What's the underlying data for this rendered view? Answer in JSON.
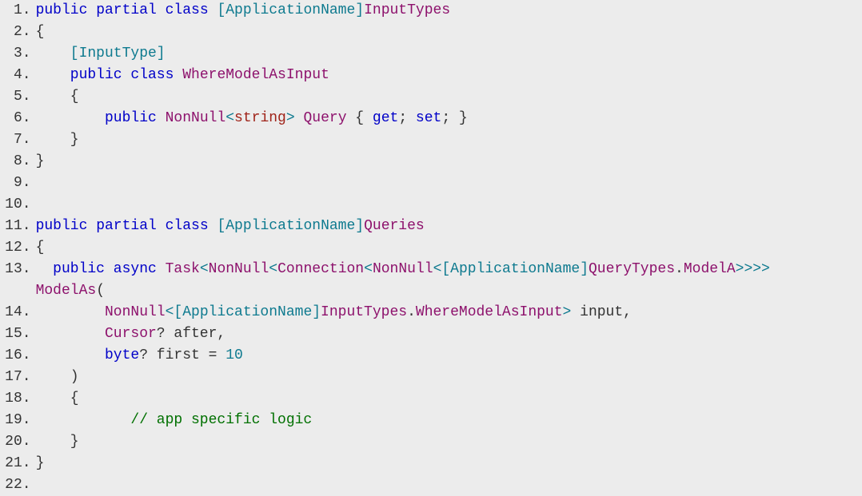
{
  "lines": {
    "l1": {
      "n": "1.",
      "tokens": [
        {
          "c": "k",
          "t": "public"
        },
        {
          "t": " "
        },
        {
          "c": "k",
          "t": "partial"
        },
        {
          "t": " "
        },
        {
          "c": "k",
          "t": "class"
        },
        {
          "t": " "
        },
        {
          "c": "t",
          "t": "[ApplicationName]"
        },
        {
          "c": "m",
          "t": "InputTypes"
        }
      ]
    },
    "l2": {
      "n": "2.",
      "tokens": [
        {
          "t": "{"
        }
      ]
    },
    "l3": {
      "n": "3.",
      "tokens": [
        {
          "t": "    "
        },
        {
          "c": "t",
          "t": "[InputType]"
        }
      ]
    },
    "l4": {
      "n": "4.",
      "tokens": [
        {
          "t": "    "
        },
        {
          "c": "k",
          "t": "public"
        },
        {
          "t": " "
        },
        {
          "c": "k",
          "t": "class"
        },
        {
          "t": " "
        },
        {
          "c": "m",
          "t": "WhereModelAsInput"
        }
      ]
    },
    "l5": {
      "n": "5.",
      "tokens": [
        {
          "t": "    {"
        }
      ]
    },
    "l6": {
      "n": "6.",
      "tokens": [
        {
          "t": "        "
        },
        {
          "c": "k",
          "t": "public"
        },
        {
          "t": " "
        },
        {
          "c": "m",
          "t": "NonNull"
        },
        {
          "c": "t",
          "t": "<"
        },
        {
          "c": "s",
          "t": "string"
        },
        {
          "c": "t",
          "t": ">"
        },
        {
          "t": " "
        },
        {
          "c": "m",
          "t": "Query"
        },
        {
          "t": " { "
        },
        {
          "c": "k",
          "t": "get"
        },
        {
          "t": "; "
        },
        {
          "c": "k",
          "t": "set"
        },
        {
          "t": "; }"
        }
      ]
    },
    "l7": {
      "n": "7.",
      "tokens": [
        {
          "t": "    }"
        }
      ]
    },
    "l8": {
      "n": "8.",
      "tokens": [
        {
          "t": "}"
        }
      ]
    },
    "l9": {
      "n": "9.",
      "tokens": [
        {
          "t": ""
        }
      ]
    },
    "l10": {
      "n": "10.",
      "tokens": [
        {
          "t": ""
        }
      ]
    },
    "l11": {
      "n": "11.",
      "tokens": [
        {
          "c": "k",
          "t": "public"
        },
        {
          "t": " "
        },
        {
          "c": "k",
          "t": "partial"
        },
        {
          "t": " "
        },
        {
          "c": "k",
          "t": "class"
        },
        {
          "t": " "
        },
        {
          "c": "t",
          "t": "[ApplicationName]"
        },
        {
          "c": "m",
          "t": "Queries"
        }
      ]
    },
    "l12": {
      "n": "12.",
      "tokens": [
        {
          "t": "{"
        }
      ]
    },
    "l13": {
      "n": "13.",
      "tokens": [
        {
          "t": "  "
        },
        {
          "c": "k",
          "t": "public"
        },
        {
          "t": " "
        },
        {
          "c": "k",
          "t": "async"
        },
        {
          "t": " "
        },
        {
          "c": "m",
          "t": "Task"
        },
        {
          "c": "t",
          "t": "<"
        },
        {
          "c": "m",
          "t": "NonNull"
        },
        {
          "c": "t",
          "t": "<"
        },
        {
          "c": "m",
          "t": "Connection"
        },
        {
          "c": "t",
          "t": "<"
        },
        {
          "c": "m",
          "t": "NonNull"
        },
        {
          "c": "t",
          "t": "<[ApplicationName]"
        },
        {
          "c": "m",
          "t": "QueryTypes"
        },
        {
          "t": "."
        },
        {
          "c": "m",
          "t": "ModelA"
        },
        {
          "c": "t",
          "t": ">>>>"
        }
      ]
    },
    "l13b": {
      "n": "",
      "tokens": [
        {
          "c": "m",
          "t": "ModelAs"
        },
        {
          "t": "("
        }
      ]
    },
    "l14": {
      "n": "14.",
      "tokens": [
        {
          "t": "        "
        },
        {
          "c": "m",
          "t": "NonNull"
        },
        {
          "c": "t",
          "t": "<[ApplicationName]"
        },
        {
          "c": "m",
          "t": "InputTypes"
        },
        {
          "t": "."
        },
        {
          "c": "m",
          "t": "WhereModelAsInput"
        },
        {
          "c": "t",
          "t": ">"
        },
        {
          "t": " input,"
        }
      ]
    },
    "l15": {
      "n": "15.",
      "tokens": [
        {
          "t": "        "
        },
        {
          "c": "m",
          "t": "Cursor"
        },
        {
          "t": "? after,"
        }
      ]
    },
    "l16": {
      "n": "16.",
      "tokens": [
        {
          "t": "        "
        },
        {
          "c": "k",
          "t": "byte"
        },
        {
          "t": "? first = "
        },
        {
          "c": "t",
          "t": "10"
        }
      ]
    },
    "l17": {
      "n": "17.",
      "tokens": [
        {
          "t": "    )"
        }
      ]
    },
    "l18": {
      "n": "18.",
      "tokens": [
        {
          "t": "    {"
        }
      ]
    },
    "l19": {
      "n": "19.",
      "tokens": [
        {
          "t": "           "
        },
        {
          "c": "c",
          "t": "// app specific logic"
        }
      ]
    },
    "l20": {
      "n": "20.",
      "tokens": [
        {
          "t": "    }"
        }
      ]
    },
    "l21": {
      "n": "21.",
      "tokens": [
        {
          "t": "}"
        }
      ]
    },
    "l22": {
      "n": "22.",
      "tokens": [
        {
          "t": ""
        }
      ]
    }
  },
  "order": [
    "l1",
    "l2",
    "l3",
    "l4",
    "l5",
    "l6",
    "l7",
    "l8",
    "l9",
    "l10",
    "l11",
    "l12",
    "l13",
    "l13b",
    "l14",
    "l15",
    "l16",
    "l17",
    "l18",
    "l19",
    "l20",
    "l21",
    "l22"
  ]
}
